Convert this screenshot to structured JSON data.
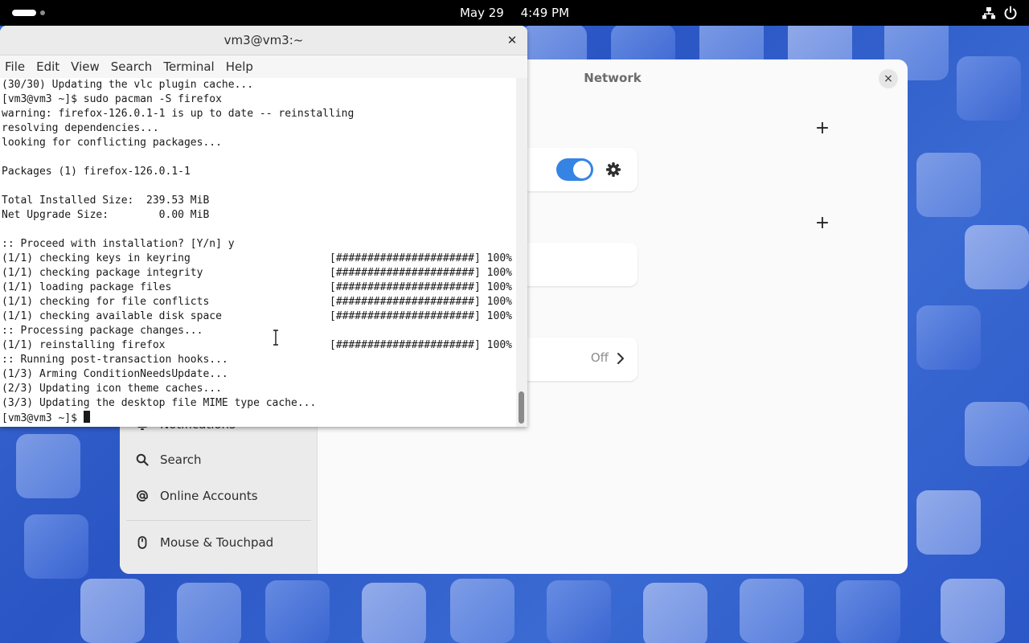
{
  "topbar": {
    "date": "May 29",
    "time": "4:49 PM",
    "icons": [
      "activities-pill",
      "workspace-dot",
      "network-icon",
      "power-icon"
    ]
  },
  "terminal": {
    "title": "vm3@vm3:~",
    "menu": [
      "File",
      "Edit",
      "View",
      "Search",
      "Terminal",
      "Help"
    ],
    "lines": [
      "(30/30) Updating the vlc plugin cache...",
      "[vm3@vm3 ~]$ sudo pacman -S firefox",
      "warning: firefox-126.0.1-1 is up to date -- reinstalling",
      "resolving dependencies...",
      "looking for conflicting packages...",
      "",
      "Packages (1) firefox-126.0.1-1",
      "",
      "Total Installed Size:  239.53 MiB",
      "Net Upgrade Size:        0.00 MiB",
      "",
      ":: Proceed with installation? [Y/n] y",
      "(1/1) checking keys in keyring",
      "(1/1) checking package integrity",
      "(1/1) loading package files",
      "(1/1) checking for file conflicts",
      "(1/1) checking available disk space",
      ":: Processing package changes...",
      "(1/1) reinstalling firefox",
      ":: Running post-transaction hooks...",
      "(1/3) Arming ConditionNeedsUpdate...",
      "(2/3) Updating icon theme caches...",
      "(3/3) Updating the desktop file MIME type cache...",
      "[vm3@vm3 ~]$ "
    ],
    "progress_text": "[######################] 100%"
  },
  "settings": {
    "title": "Network",
    "close": "×",
    "plus": "+",
    "proxy_value": "Off",
    "toggle_on": true,
    "sidebar": [
      {
        "label": "Notifications",
        "icon": "bell-icon"
      },
      {
        "label": "Search",
        "icon": "search-icon"
      },
      {
        "label": "Online Accounts",
        "icon": "at-icon"
      },
      {
        "label": "Mouse & Touchpad",
        "icon": "mouse-icon"
      }
    ]
  },
  "colors": {
    "accent": "#3584e4",
    "topbar": "#000000",
    "wallpaper": "#2f5ecb"
  }
}
